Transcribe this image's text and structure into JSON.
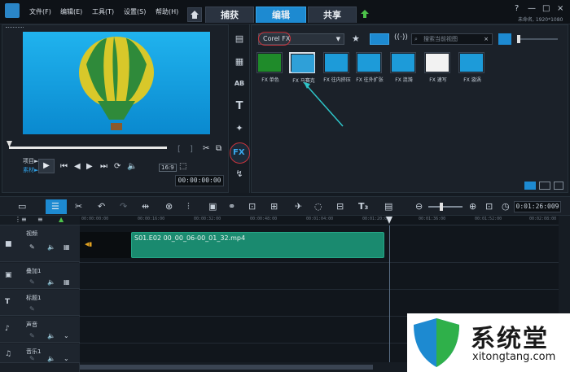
{
  "topbar": {
    "menu": [
      "文件(F)",
      "编辑(E)",
      "工具(T)",
      "设置(S)",
      "帮助(H)"
    ],
    "tabs": [
      {
        "label": "捕获"
      },
      {
        "label": "编辑"
      },
      {
        "label": "共享"
      }
    ],
    "resolution": "未命名, 1920*1080",
    "window_controls": [
      "?",
      "—",
      "□",
      "×"
    ]
  },
  "preview": {
    "project_label": "项目►",
    "clip_label": "素材►",
    "aspect": "16:9",
    "timecode": "00:00:00:00"
  },
  "library": {
    "filter_dropdown": "Corel FX",
    "search_placeholder": "搜索当前视图",
    "thumbnails": [
      {
        "label": "FX 单色",
        "color": "#1f8b2a"
      },
      {
        "label": "FX 马赛克",
        "color": "#2fa0d8"
      },
      {
        "label": "FX 往内挤压",
        "color": "#1d9bd9"
      },
      {
        "label": "FX 往外扩张",
        "color": "#1d9bd9"
      },
      {
        "label": "FX 涟漪",
        "color": "#1d9bd9"
      },
      {
        "label": "FX 速写",
        "color": "#f2f2f2"
      },
      {
        "label": "FX 漩涡",
        "color": "#1d9bd9"
      }
    ]
  },
  "timeline": {
    "timecode": "0:01:26:009",
    "ruler_ticks": [
      "00:00:00:00",
      "00:00:16:00",
      "00:00:32:00",
      "00:00:48:00",
      "00:01:04:00",
      "00:01:20:00",
      "00:01:36:00",
      "00:01:52:00",
      "00:02:08:00"
    ],
    "tracks": [
      {
        "name": "视频",
        "icon": "film-icon"
      },
      {
        "name": "叠加1",
        "icon": "overlay-icon"
      },
      {
        "name": "标题1",
        "icon": "title-icon"
      },
      {
        "name": "声音",
        "icon": "voice-icon"
      },
      {
        "name": "音乐1",
        "icon": "music-icon"
      }
    ],
    "clip": {
      "label": "S01.E02 00_00_06-00_01_32.mp4"
    }
  },
  "watermark": {
    "title": "系统堂",
    "url": "xitongtang.com"
  }
}
